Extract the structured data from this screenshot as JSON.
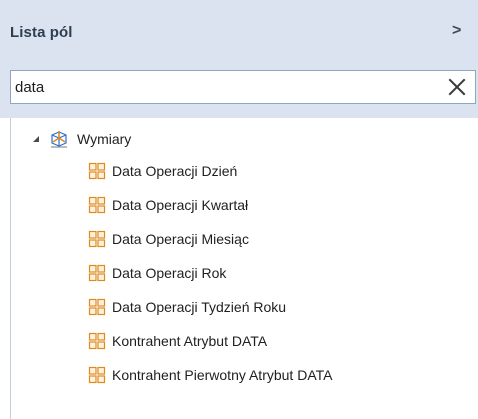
{
  "header": {
    "title": "Lista pól",
    "chevron": ">"
  },
  "search": {
    "value": "data",
    "clear_icon": "close-icon"
  },
  "tree": {
    "root": {
      "label": "Wymiary",
      "icon": "dimensions-cube-icon",
      "expanded": true
    },
    "items": [
      {
        "label": "Data Operacji Dzień",
        "icon": "dimension-attribute-icon"
      },
      {
        "label": "Data Operacji Kwartał",
        "icon": "dimension-attribute-icon"
      },
      {
        "label": "Data Operacji Miesiąc",
        "icon": "dimension-attribute-icon"
      },
      {
        "label": "Data Operacji Rok",
        "icon": "dimension-attribute-icon"
      },
      {
        "label": "Data Operacji Tydzień Roku",
        "icon": "dimension-attribute-icon"
      },
      {
        "label": "Kontrahent Atrybut DATA",
        "icon": "dimension-attribute-icon"
      },
      {
        "label": "Kontrahent Pierwotny Atrybut DATA",
        "icon": "dimension-attribute-icon"
      }
    ]
  },
  "colors": {
    "header_bg": "#dae3ef",
    "title_text": "#2e3e52",
    "icon_orange": "#e08a1e",
    "icon_blue": "#2f6fd0"
  }
}
